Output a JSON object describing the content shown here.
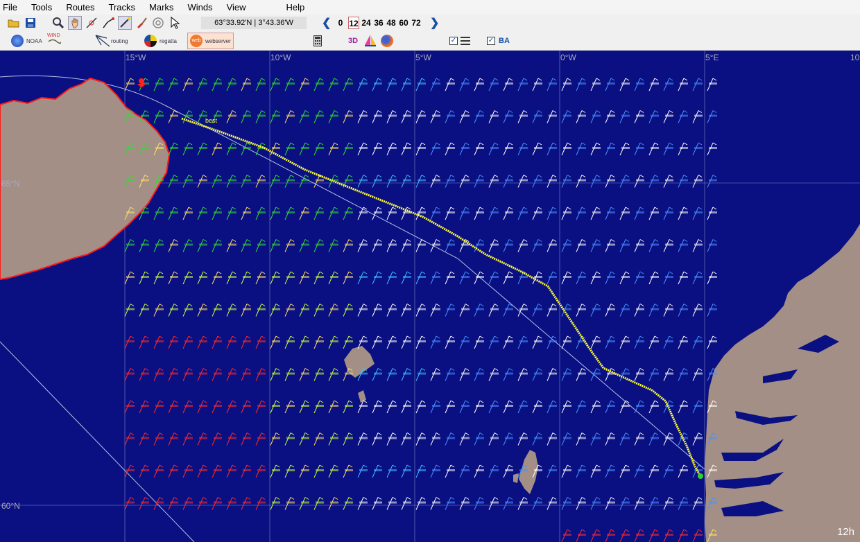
{
  "menu": [
    "File",
    "Tools",
    "Routes",
    "Tracks",
    "Marks",
    "Winds",
    "View",
    "Help"
  ],
  "toolbar": {
    "coordinates": "63°33.92'N | 3°43.36'W",
    "hours": [
      "0",
      "12",
      "24",
      "36",
      "48",
      "60",
      "72"
    ],
    "active_hour": "12",
    "icons": [
      "open-folder-icon",
      "save-icon",
      "zoom-icon",
      "pan-hand-icon",
      "measure-icon",
      "route-line-icon",
      "pen-icon",
      "paint-icon",
      "target-icon",
      "pointer-icon"
    ]
  },
  "toolbar2": {
    "noaa": "NOAA",
    "wind": "WIND",
    "routing": "routing",
    "regatta": "regatta",
    "webserver": "webserver",
    "threed": "3D",
    "ba": "BA"
  },
  "map": {
    "lon_labels": [
      "15°W",
      "10°W",
      "5°W",
      "0°W",
      "5°E",
      "10"
    ],
    "lat_labels": [
      "65°N",
      "60°N"
    ],
    "route_start_label": "best",
    "time_label": "12h",
    "colors": {
      "sea": "#0a1082",
      "land": "#a38f86",
      "coast_iceland": "#ff1a1a",
      "route": "#ffff33",
      "great_circle": "#b8c0e6"
    }
  }
}
